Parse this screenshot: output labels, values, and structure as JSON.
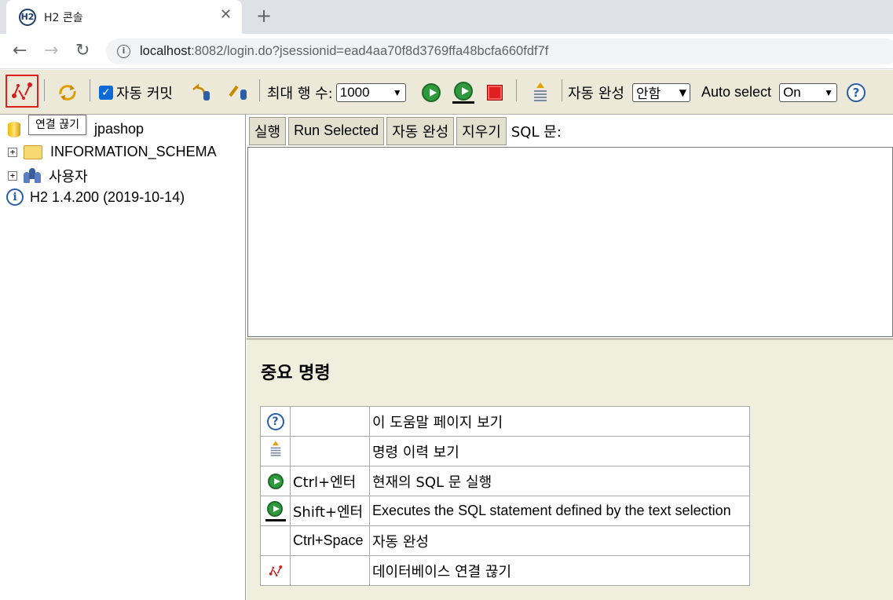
{
  "browser": {
    "tab_title": "H2 콘솔",
    "favicon_text": "H2",
    "close_glyph": "✕",
    "newtab_glyph": "+",
    "back_glyph": "←",
    "forward_glyph": "→",
    "reload_glyph": "↻",
    "url_host": "localhost",
    "url_rest": ":8082/login.do?jsessionid=ead4aa70f8d3769ffa48bcfa660fdf7f"
  },
  "toolbar": {
    "auto_commit_label": "자동 커밋",
    "max_rows_label": "최대 행 수:",
    "max_rows_value": "1000",
    "autocomplete_label": "자동 완성",
    "autocomplete_value": "안함",
    "auto_select_label": "Auto select",
    "auto_select_value": "On",
    "help_glyph": "?",
    "tooltip": "연결 끊기"
  },
  "tree": {
    "db_name": "jpashop",
    "schema": "INFORMATION_SCHEMA",
    "users": "사용자",
    "version": "H2 1.4.200 (2019-10-14)"
  },
  "sql": {
    "run": "실행",
    "run_selected": "Run Selected",
    "autocomplete": "자동 완성",
    "clear": "지우기",
    "statement_label": "SQL 문:"
  },
  "help": {
    "title": "중요 명령",
    "rows": [
      {
        "key": "",
        "desc": "이 도움말 페이지 보기"
      },
      {
        "key": "",
        "desc": "명령 이력 보기"
      },
      {
        "key": "Ctrl+엔터",
        "desc": "현재의 SQL 문 실행"
      },
      {
        "key": "Shift+엔터",
        "desc": "Executes the SQL statement defined by the text selection"
      },
      {
        "key": "Ctrl+Space",
        "desc": "자동 완성"
      },
      {
        "key": "",
        "desc": "데이터베이스 연결 끊기"
      }
    ]
  },
  "colors": {
    "toolbar_bg": "#ece9d8",
    "help_bg": "#f0eedd",
    "accent_red": "#e02020",
    "run_green": "#2f9a3c"
  }
}
